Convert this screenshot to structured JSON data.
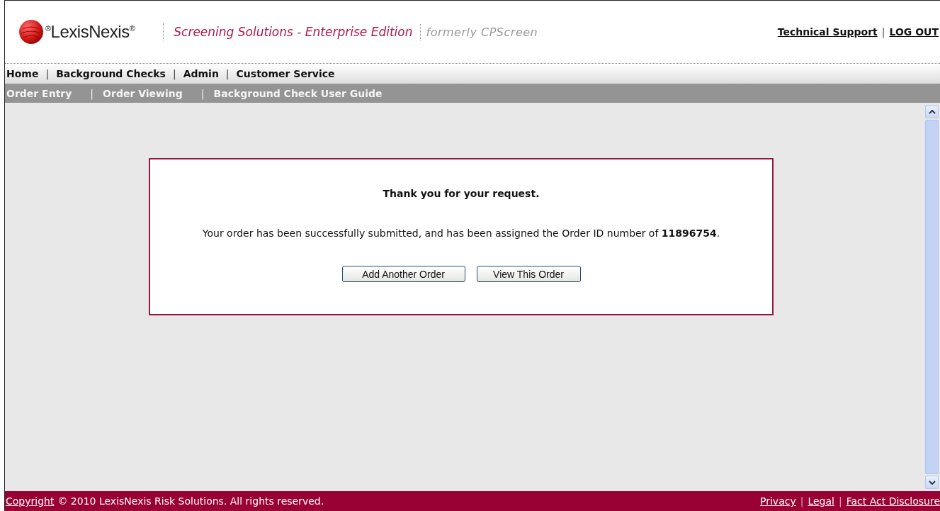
{
  "header": {
    "logo": "$^{®}$LexisNexis$^{®}$",
    "product": "Screening Solutions - Enterprise Edition",
    "formerly": "formerly CPScreen",
    "links": [
      {
        "label": "Technical Support"
      },
      {
        "label": "LOG OUT"
      }
    ],
    "link_separator": "|"
  },
  "main_nav": {
    "separator": "|",
    "items": [
      {
        "label": "Home"
      },
      {
        "label": "Background Checks"
      },
      {
        "label": "Admin"
      },
      {
        "label": "Customer Service"
      }
    ]
  },
  "sub_nav": {
    "separator": "|",
    "items": [
      {
        "label": "Order Entry"
      },
      {
        "label": "Order Viewing"
      },
      {
        "label": "Background Check User Guide"
      }
    ]
  },
  "confirmation": {
    "heading": "Thank you for your request.",
    "message": "Your order has been successfully submitted, and has been assigned the Order ID number of **11896754**.",
    "buttons": [
      "Add Another Order",
      "View This Order"
    ]
  },
  "footer": {
    "copyright_link": "Copyright",
    "copyright_text": "© 2010 LexisNexis Risk Solutions. All rights reserved.",
    "separator": "|",
    "links": [
      {
        "label": "Privacy"
      },
      {
        "label": "Legal"
      },
      {
        "label": "Fact Act Disclosure"
      }
    ]
  }
}
